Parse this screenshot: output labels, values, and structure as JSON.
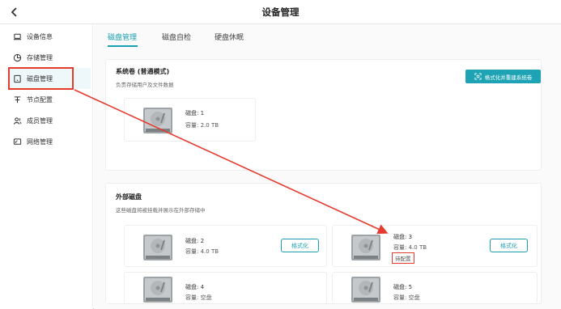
{
  "header": {
    "title": "设备管理",
    "back_icon": "chevron-left-icon"
  },
  "sidebar": {
    "items": [
      {
        "label": "设备信息",
        "icon": "laptop-icon",
        "active": false
      },
      {
        "label": "存储管理",
        "icon": "pie-chart-icon",
        "active": false
      },
      {
        "label": "磁盘管理",
        "icon": "disk-icon",
        "active": true
      },
      {
        "label": "节点配置",
        "icon": "nodes-icon",
        "active": false
      },
      {
        "label": "成员管理",
        "icon": "users-icon",
        "active": false
      },
      {
        "label": "网络管理",
        "icon": "network-icon",
        "active": false
      }
    ]
  },
  "tabs": [
    {
      "label": "磁盘管理",
      "active": true
    },
    {
      "label": "磁盘自检",
      "active": false
    },
    {
      "label": "硬盘休眠",
      "active": false
    }
  ],
  "system_volume": {
    "title": "系统卷 (普通模式)",
    "desc": "负责存储用户及文件数据",
    "button_label": "格式化并重建系统卷",
    "disk": {
      "name": "磁盘: 1",
      "size": "容量: 2.0 TB"
    }
  },
  "external": {
    "title": "外部磁盘",
    "desc": "这些磁盘将被挂载并展示在外部存储中",
    "disks": [
      {
        "name": "磁盘: 2",
        "size": "容量: 4.0 TB",
        "button_label": "格式化"
      },
      {
        "name": "磁盘: 3",
        "size": "容量: 4.0 TB",
        "button_label": "格式化",
        "badge": "待配置"
      },
      {
        "name": "磁盘: 4",
        "size": "容量: 空盘"
      },
      {
        "name": "磁盘: 5",
        "size": "容量: 空盘"
      }
    ]
  },
  "colors": {
    "accent": "#1da3b4",
    "annotation": "#e53a2e"
  }
}
